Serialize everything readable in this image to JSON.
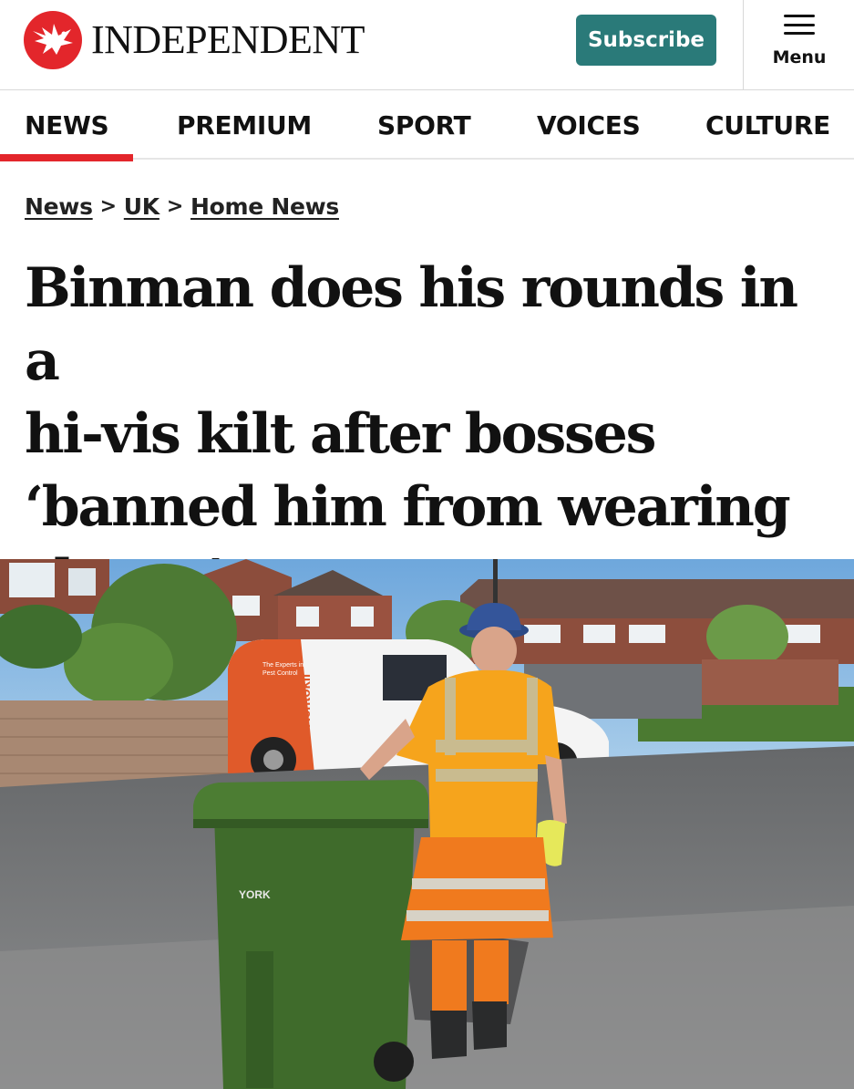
{
  "header": {
    "brand": "INDEPENDENT",
    "subscribe_label": "Subscribe",
    "menu_label": "Menu",
    "brand_color": "#e3262b",
    "subscribe_color": "#2a7a79"
  },
  "nav": {
    "items": [
      {
        "label": "NEWS",
        "active": true
      },
      {
        "label": "PREMIUM",
        "active": false
      },
      {
        "label": "SPORT",
        "active": false
      },
      {
        "label": "VOICES",
        "active": false
      },
      {
        "label": "CULTURE",
        "active": false
      }
    ]
  },
  "breadcrumb": {
    "items": [
      "News",
      "UK",
      "Home News"
    ],
    "separator": ">"
  },
  "article": {
    "headline_lines": [
      "Binman does his rounds in a",
      "hi-vis kilt after bosses",
      "‘banned him from wearing",
      "shorts’"
    ]
  },
  "photo": {
    "van_brand": "Rentokil",
    "van_tagline_1": "The Experts in",
    "van_tagline_2": "Pest Control",
    "bin_label": "YORK"
  }
}
